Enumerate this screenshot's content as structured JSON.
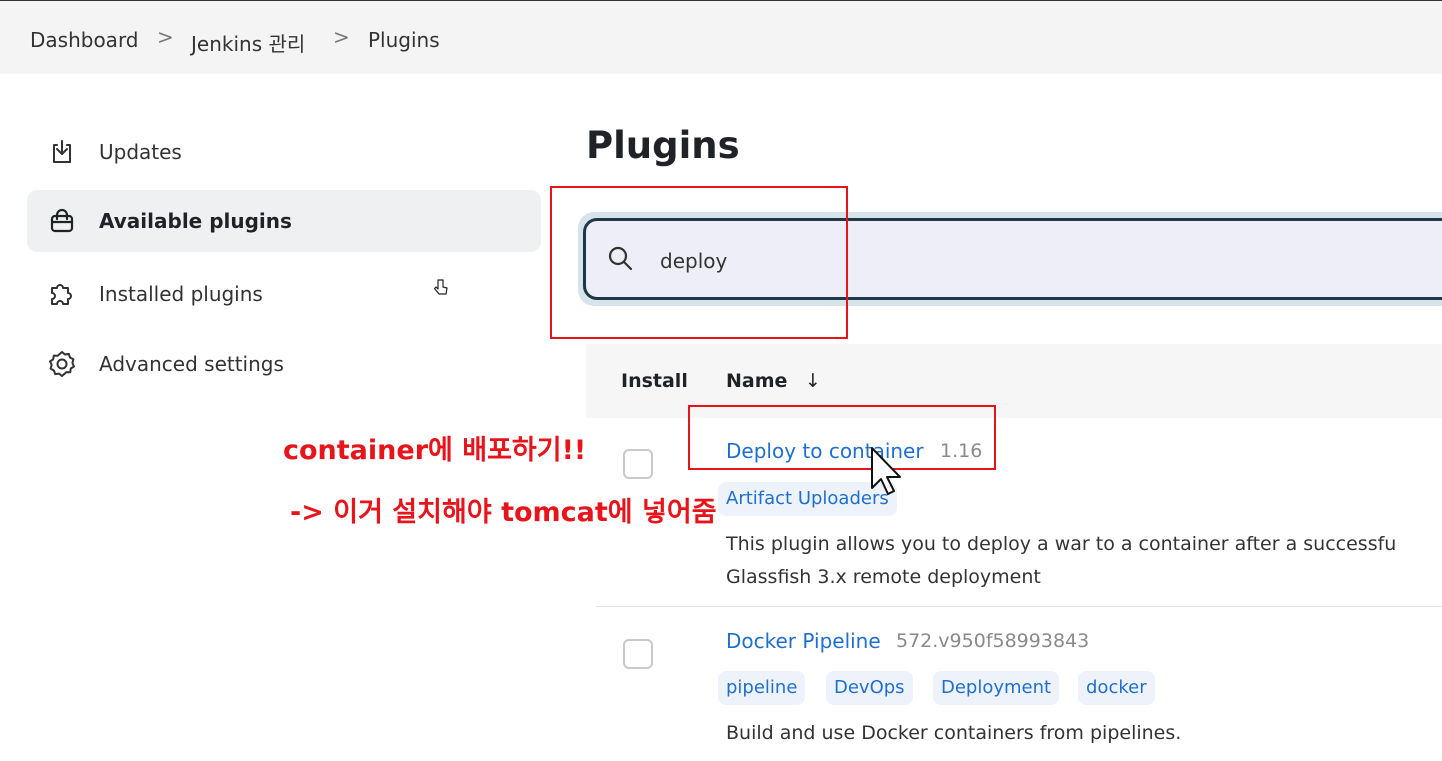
{
  "breadcrumb": {
    "items": [
      "Dashboard",
      "Jenkins 관리",
      "Plugins"
    ],
    "separator": ">"
  },
  "sidebar": {
    "items": [
      {
        "label": "Updates",
        "icon": "download-icon"
      },
      {
        "label": "Available plugins",
        "icon": "shopping-bag-icon",
        "active": true
      },
      {
        "label": "Installed plugins",
        "icon": "puzzle-icon"
      },
      {
        "label": "Advanced settings",
        "icon": "gear-icon"
      }
    ]
  },
  "main": {
    "title": "Plugins",
    "search": {
      "value": "deploy",
      "icon": "search-icon"
    },
    "table": {
      "headers": {
        "install": "Install",
        "name": "Name",
        "sort_indicator": "↓"
      },
      "rows": [
        {
          "name": "Deploy to container",
          "version": "1.16",
          "tags": [
            "Artifact Uploaders"
          ],
          "description": [
            "This plugin allows you to deploy a war to a container after a successfu",
            "Glassfish 3.x remote deployment"
          ]
        },
        {
          "name": "Docker Pipeline",
          "version": "572.v950f58993843",
          "tags": [
            "pipeline",
            "DevOps",
            "Deployment",
            "docker"
          ],
          "description": [
            "Build and use Docker containers from pipelines."
          ]
        }
      ]
    }
  },
  "annotations": {
    "line1": "container에 배포하기!!",
    "line2": "-> 이거 설치해야 tomcat에 넣어줌",
    "color": "#e8141b"
  },
  "colors": {
    "link": "#1f6fd0",
    "search_border": "#1f3848",
    "search_bg": "#eeeef9",
    "active_item_bg": "#eff0f1"
  }
}
